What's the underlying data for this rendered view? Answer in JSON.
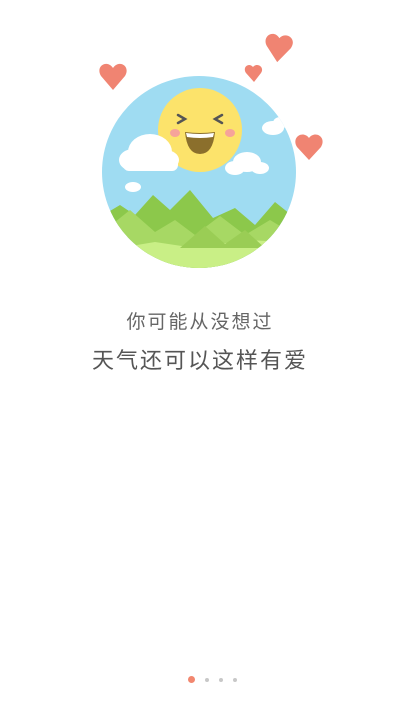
{
  "onboarding": {
    "subtitle": "你可能从没想过",
    "title": "天气还可以这样有爱",
    "illustration_icon": "sunny-landscape-illustration",
    "page_count": 4,
    "active_page": 1
  },
  "colors": {
    "sky": "#9fdcf2",
    "sun": "#fce36b",
    "heart": "#f08472",
    "hills": "#9ad05a",
    "ground": "#c9ef86",
    "active_dot": "#f2876f",
    "inactive_dot": "#c8c8c8"
  }
}
